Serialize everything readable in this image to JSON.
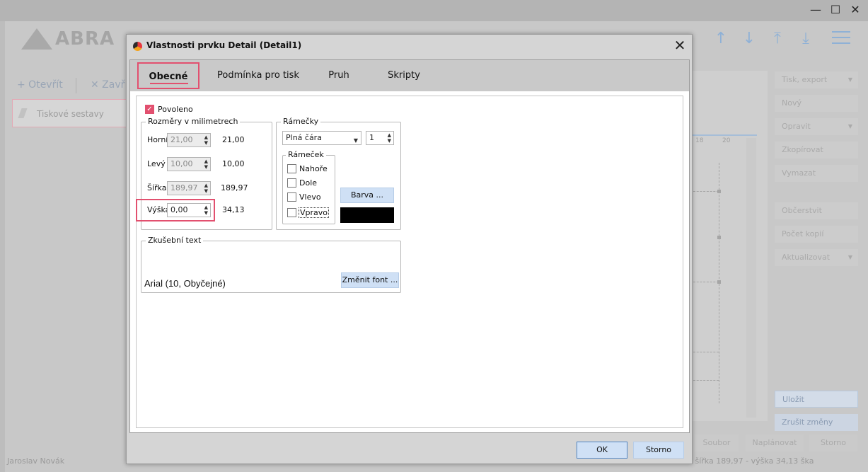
{
  "app": {
    "logo_text": "ABRA",
    "toolbar": {
      "open_label": "+ Otevřít",
      "close_label": "✕ Zavř"
    },
    "report_item_label": "Tiskové sestavy",
    "ruler": [
      "18",
      "20"
    ],
    "right_buttons": {
      "tisk": "Tisk, export",
      "novy": "Nový",
      "opravit": "Opravit",
      "zkopirovat": "Zkopírovat",
      "vymazat": "Vymazat",
      "obcerstvit": "Občerstvit",
      "pocet": "Počet kopií",
      "aktualizovat": "Aktualizovat",
      "ulozit": "Uložit",
      "zrusit": "Zrušit změny"
    },
    "bottom_buttons": {
      "soubor": "Soubor",
      "naplanovat": "Naplánovat",
      "storno": "Storno"
    },
    "status_user": "Jaroslav Novák",
    "status_right": "- šířka 189,97 - výška 34,13     ška"
  },
  "dialog": {
    "title": "Vlastnosti prvku Detail (Detail1)",
    "tabs": [
      "Obecné",
      "Podmínka pro tisk",
      "Pruh",
      "Skripty"
    ],
    "povoleno_label": "Povoleno",
    "rozmery": {
      "title": "Rozměry v milimetrech",
      "rows": [
        {
          "label": "Horní",
          "input": "21,00",
          "value": "21,00"
        },
        {
          "label": "Levý",
          "input": "10,00",
          "value": "10,00"
        },
        {
          "label": "Šířka",
          "input": "189,97",
          "value": "189,97"
        },
        {
          "label": "Výška",
          "input": "0,00",
          "value": "34,13"
        }
      ]
    },
    "ramecky": {
      "title": "Rámečky",
      "line_style": "Plná čára",
      "line_width": "1",
      "ramecek_title": "Rámeček",
      "sides": [
        "Nahoře",
        "Dole",
        "Vlevo",
        "Vpravo"
      ],
      "color_button": "Barva ...",
      "color": "#000000"
    },
    "zkusebni": {
      "title": "Zkušební text",
      "font_text": "Arial (10, Obyčejné)",
      "change_font": "Změnit font ..."
    },
    "ok_label": "OK",
    "cancel_label": "Storno"
  }
}
